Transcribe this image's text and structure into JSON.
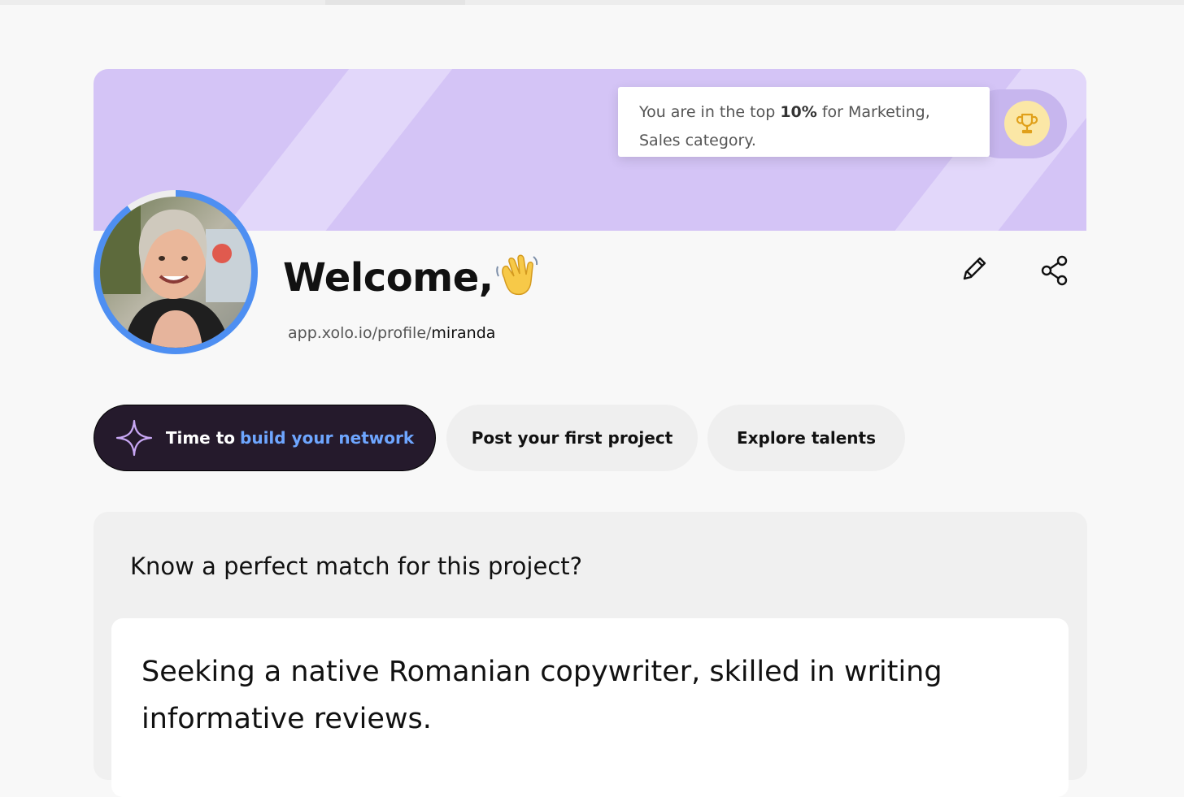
{
  "banner": {
    "rank_prefix": "You are in the top ",
    "rank_value": "10%",
    "rank_suffix": " for Marketing,",
    "rank_line2": "Sales category."
  },
  "profile": {
    "welcome": "Welcome,",
    "url_base": "app.xolo.io/profile/",
    "username": "miranda",
    "profile_completion": 0.9
  },
  "actions": {
    "primary_prefix": "Time to",
    "primary_highlight": "build your network",
    "post_project": "Post your first project",
    "explore_talents": "Explore talents"
  },
  "match": {
    "heading": "Know a perfect match for this project?",
    "project_text": "Seeking a native Romanian copywriter, skilled in writing informative reviews."
  },
  "icons": {
    "trophy": "trophy-icon",
    "edit": "pencil-icon",
    "share": "share-icon",
    "sparkle": "sparkle-icon",
    "wave": "waving-hand-emoji"
  },
  "colors": {
    "banner": "#d4c4f6",
    "primary_button": "#251a2c",
    "highlight": "#6ea6ff",
    "avatar_ring": "#4e8ff2"
  }
}
